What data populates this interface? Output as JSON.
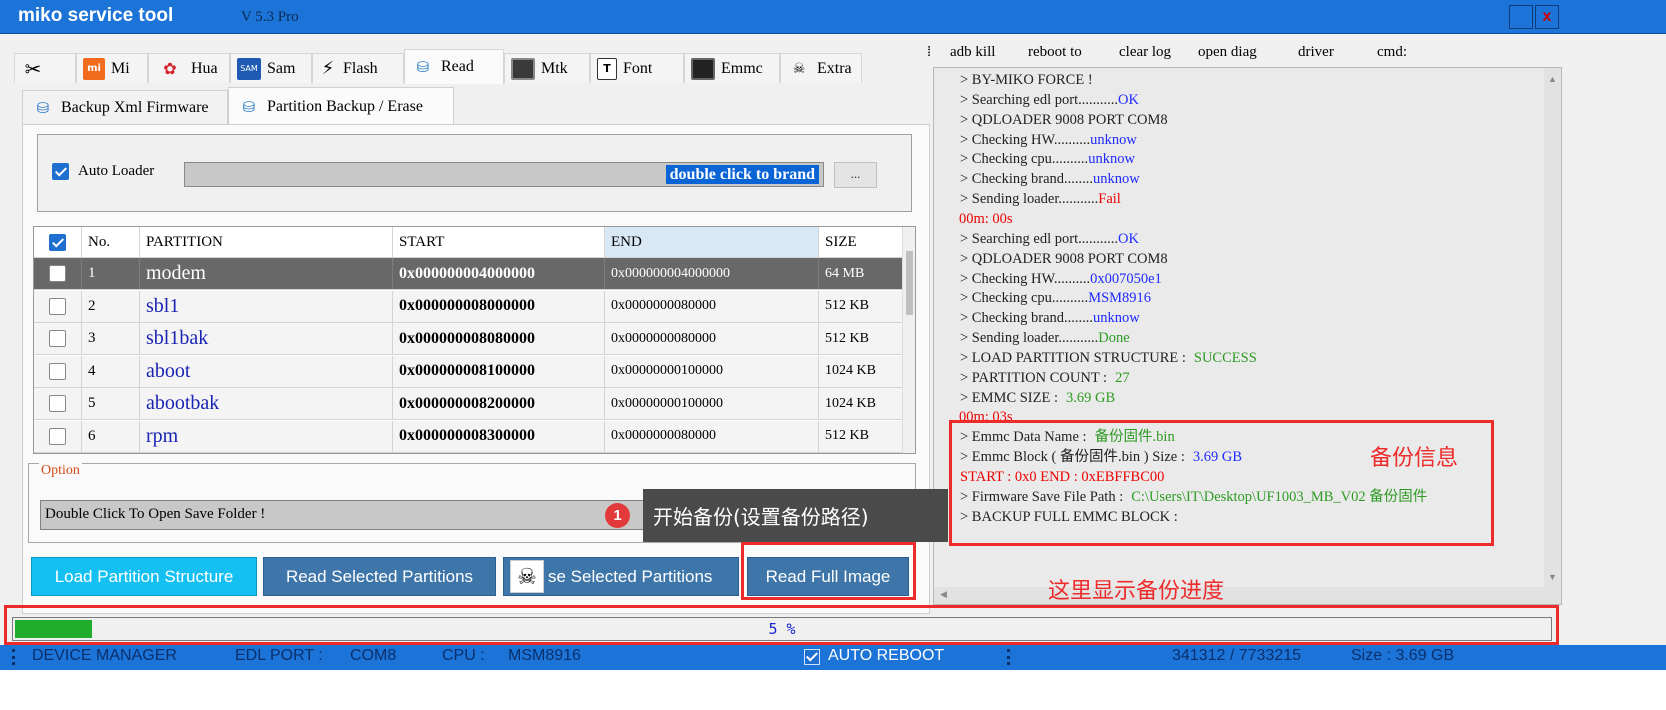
{
  "app": {
    "title": "miko service tool",
    "version": "V 5.3 Pro",
    "close_glyph": "x"
  },
  "tabs": [
    {
      "label": "",
      "icon": "tools-icon"
    },
    {
      "label": "Mi",
      "icon": "xiaomi-icon"
    },
    {
      "label": "Hua",
      "icon": "huawei-icon"
    },
    {
      "label": "Sam",
      "icon": "samsung-icon"
    },
    {
      "label": "Flash",
      "icon": "lightning-icon"
    },
    {
      "label": "Read",
      "icon": "database-icon"
    },
    {
      "label": "Mtk",
      "icon": "chip-icon"
    },
    {
      "label": "Font",
      "icon": "font-icon"
    },
    {
      "label": "Emmc",
      "icon": "emmc-icon"
    },
    {
      "label": "Extra",
      "icon": "extra-icon"
    }
  ],
  "subtabs": [
    {
      "label": "Backup Xml Firmware"
    },
    {
      "label": "Partition Backup / Erase"
    }
  ],
  "loader": {
    "auto_loader_label": "Auto Loader",
    "auto_loader_checked": true,
    "brand_value": "double click to brand",
    "browse_label": "..."
  },
  "table": {
    "columns": [
      "No.",
      "PARTITION",
      "START",
      "END",
      "SIZE"
    ],
    "rows": [
      {
        "no": "1",
        "partition": "modem",
        "start": "0x000000004000000",
        "end": "0x000000004000000",
        "size": "64 MB",
        "checked": false,
        "selected": true
      },
      {
        "no": "2",
        "partition": "sbl1",
        "start": "0x000000008000000",
        "end": "0x0000000080000",
        "size": "512 KB",
        "checked": false,
        "selected": false
      },
      {
        "no": "3",
        "partition": "sbl1bak",
        "start": "0x000000008080000",
        "end": "0x0000000080000",
        "size": "512 KB",
        "checked": false,
        "selected": false
      },
      {
        "no": "4",
        "partition": "aboot",
        "start": "0x000000008100000",
        "end": "0x00000000100000",
        "size": "1024 KB",
        "checked": false,
        "selected": false
      },
      {
        "no": "5",
        "partition": "abootbak",
        "start": "0x000000008200000",
        "end": "0x00000000100000",
        "size": "1024 KB",
        "checked": false,
        "selected": false
      },
      {
        "no": "6",
        "partition": "rpm",
        "start": "0x000000008300000",
        "end": "0x0000000080000",
        "size": "512 KB",
        "checked": false,
        "selected": false
      }
    ]
  },
  "option": {
    "label": "Option",
    "save_folder_text": "Double Click To Open Save Folder !"
  },
  "buttons": {
    "load": "Load Partition Structure",
    "read_selected": "Read Selected Partitions",
    "erase_selected": "se Selected Partitions",
    "read_full": "Read Full Image"
  },
  "log_menu": [
    "adb kill",
    "reboot to",
    "clear log",
    "open diag",
    "driver",
    "cmd:"
  ],
  "log": [
    {
      "t": "> BY-MIKO FORCE !",
      "v": "",
      "c": ""
    },
    {
      "t": "> Searching edl port...........",
      "v": "OK",
      "c": "blue"
    },
    {
      "t": "> QDLOADER 9008 PORT COM8",
      "v": "",
      "c": ""
    },
    {
      "t": "> Checking HW..........",
      "v": "unknow",
      "c": "blue"
    },
    {
      "t": "> Checking cpu..........",
      "v": "unknow",
      "c": "blue"
    },
    {
      "t": "> Checking brand........",
      "v": "unknow",
      "c": "blue"
    },
    {
      "t": "> Sending loader...........",
      "v": "Fail",
      "c": "red"
    },
    {
      "t": "00m: 00s",
      "v": "",
      "c": "time"
    },
    {
      "t": "> Searching edl port...........",
      "v": "OK",
      "c": "blue"
    },
    {
      "t": "> QDLOADER 9008 PORT COM8",
      "v": "",
      "c": ""
    },
    {
      "t": "> Checking HW..........",
      "v": "0x007050e1",
      "c": "blue"
    },
    {
      "t": "> Checking cpu..........",
      "v": "MSM8916",
      "c": "blue"
    },
    {
      "t": "> Checking brand........",
      "v": "unknow",
      "c": "blue"
    },
    {
      "t": "> Sending loader...........",
      "v": "Done",
      "c": "green"
    },
    {
      "t": "> LOAD PARTITION  STRUCTURE  :",
      "v": "SUCCESS",
      "c": "green"
    },
    {
      "t": "> PARTITION COUNT  :",
      "v": "27",
      "c": "green"
    },
    {
      "t": "> EMMC SIZE   :",
      "v": "3.69 GB",
      "c": "green"
    },
    {
      "t": "00m: 03s",
      "v": "",
      "c": "time"
    },
    {
      "t": "> Emmc Data Name  :",
      "v": "备份固件.bin",
      "c": "green"
    },
    {
      "t": "> Emmc Block ( 备份固件.bin ) Size    :",
      "v": "3.69 GB",
      "c": "blue"
    },
    {
      "t": " START  :  0x0    END  :    0xEBFFBC00",
      "v": "",
      "c": "redline"
    },
    {
      "t": "> Firmware Save File  Path :",
      "v": "C:\\Users\\IT\\Desktop\\UF1003_MB_V02 备份固件",
      "c": "green"
    },
    {
      "t": "> BACKUP FULL EMMC BLOCK   :",
      "v": "",
      "c": ""
    }
  ],
  "annotations": {
    "backup_info": "备份信息",
    "progress_hint": "这里显示备份进度",
    "tooltip": "开始备份(设置备份路径)",
    "step_badge": "1"
  },
  "progress": {
    "percent": 5,
    "label": "5 %"
  },
  "status": {
    "device_manager": "DEVICE MANAGER",
    "edl_port_label": "EDL PORT :",
    "edl_port": "COM8",
    "cpu_label": "CPU :",
    "cpu": "MSM8916",
    "auto_reboot": "AUTO REBOOT",
    "blocks": "341312   /   7733215",
    "size": "Size  :  3.69 GB"
  }
}
